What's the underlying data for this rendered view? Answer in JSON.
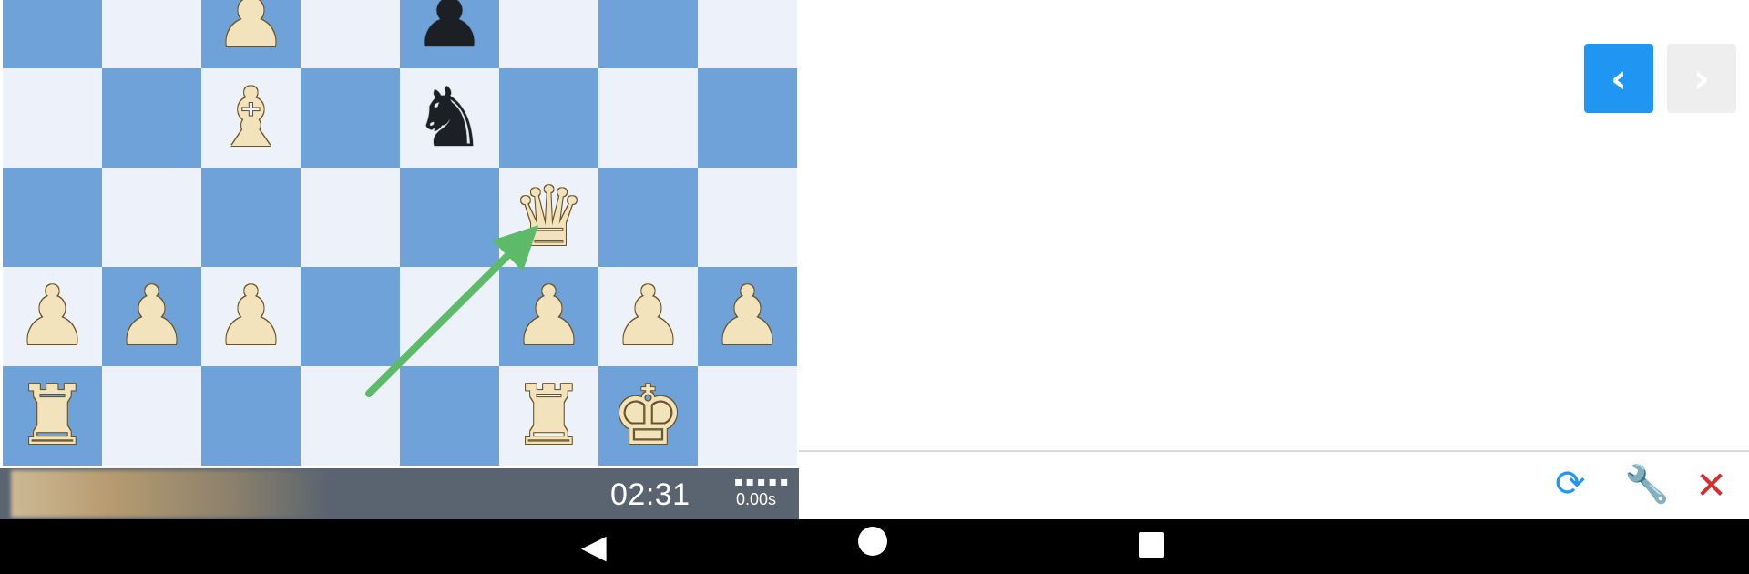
{
  "board": {
    "light_color": "#edf1f9",
    "dark_color": "#6fa2d8",
    "arrow_color": "#5cba68",
    "pieces": [
      {
        "row": 0,
        "col": 2,
        "glyph": "♟",
        "side": "white",
        "name": "white-pawn"
      },
      {
        "row": 0,
        "col": 4,
        "glyph": "♟",
        "side": "black",
        "name": "black-pawn"
      },
      {
        "row": 1,
        "col": 2,
        "glyph": "♝",
        "side": "white",
        "name": "white-bishop"
      },
      {
        "row": 1,
        "col": 4,
        "glyph": "♞",
        "side": "black",
        "name": "black-knight"
      },
      {
        "row": 2,
        "col": 5,
        "glyph": "♛",
        "side": "white",
        "name": "white-queen"
      },
      {
        "row": 3,
        "col": 0,
        "glyph": "♟",
        "side": "white",
        "name": "white-pawn"
      },
      {
        "row": 3,
        "col": 1,
        "glyph": "♟",
        "side": "white",
        "name": "white-pawn"
      },
      {
        "row": 3,
        "col": 2,
        "glyph": "♟",
        "side": "white",
        "name": "white-pawn"
      },
      {
        "row": 3,
        "col": 5,
        "glyph": "♟",
        "side": "white",
        "name": "white-pawn"
      },
      {
        "row": 3,
        "col": 6,
        "glyph": "♟",
        "side": "white",
        "name": "white-pawn"
      },
      {
        "row": 3,
        "col": 7,
        "glyph": "♟",
        "side": "white",
        "name": "white-pawn"
      },
      {
        "row": 4,
        "col": 0,
        "glyph": "♜",
        "side": "white",
        "name": "white-rook"
      },
      {
        "row": 4,
        "col": 5,
        "glyph": "♜",
        "side": "white",
        "name": "white-rook"
      },
      {
        "row": 4,
        "col": 6,
        "glyph": "♚",
        "side": "white",
        "name": "white-king"
      }
    ]
  },
  "status": {
    "clock": "02:31",
    "think_dots": "▪▪▪▪▪",
    "think_time": "0.00s"
  },
  "nav": {
    "prev_icon": "chevron-left-icon",
    "prev_glyph": "‹",
    "next_icon": "chevron-right-icon",
    "next_glyph": "›",
    "accent": "#2096f3"
  },
  "toolbar": {
    "refresh_glyph": "⟳",
    "wrench_glyph": "🔧",
    "close_glyph": "✕"
  },
  "system_nav": {
    "back_glyph": "◀"
  }
}
